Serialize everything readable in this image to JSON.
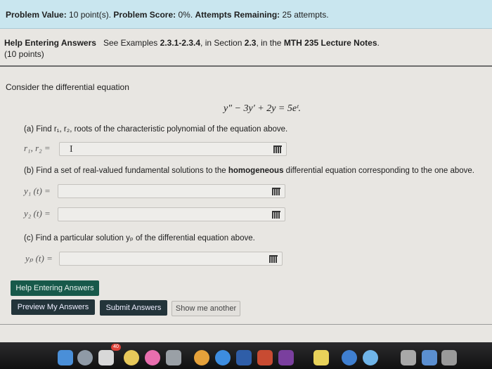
{
  "header": {
    "problem_value_label": "Problem Value:",
    "problem_value": "10 point(s).",
    "problem_score_label": "Problem Score:",
    "problem_score": "0%.",
    "attempts_label": "Attempts Remaining:",
    "attempts": "25 attempts."
  },
  "help": {
    "title": "Help Entering Answers",
    "see_text": "See Examples",
    "examples": "2.3.1-2.3.4",
    "in_section": ", in Section",
    "section": "2.3",
    "in_the": ", in the",
    "notes": "MTH 235 Lecture Notes",
    "period": ".",
    "points": "(10 points)"
  },
  "problem": {
    "consider": "Consider the differential equation",
    "equation": "y″ − 3y′ + 2y = 5eᵗ.",
    "part_a": "(a) Find r₁, r₂, roots of the characteristic polynomial of the equation above.",
    "label_a": "r₁, r₂ =",
    "part_b_pre": "(b) Find a set of real-valued fundamental solutions to the",
    "part_b_bold": "homogeneous",
    "part_b_post": "differential equation corresponding to the one above.",
    "label_y1": "y₁ (t) =",
    "label_y2": "y₂ (t) =",
    "part_c": "(c) Find a particular solution yₚ of the differential equation above.",
    "label_yp": "yₚ (t) ="
  },
  "buttons": {
    "help": "Help Entering Answers",
    "preview": "Preview My Answers",
    "submit": "Submit Answers",
    "another": "Show me another"
  },
  "dock": {
    "badge": "40",
    "icons": [
      "finder-icon",
      "launchpad-icon",
      "messages-icon",
      "photos-icon",
      "itunes-icon",
      "app-icon",
      "chrome-icon",
      "safari-icon",
      "word-icon",
      "powerpoint-icon",
      "onenote-icon",
      "notes-icon",
      "stickies-icon",
      "search-icon",
      "trash-icon"
    ]
  }
}
